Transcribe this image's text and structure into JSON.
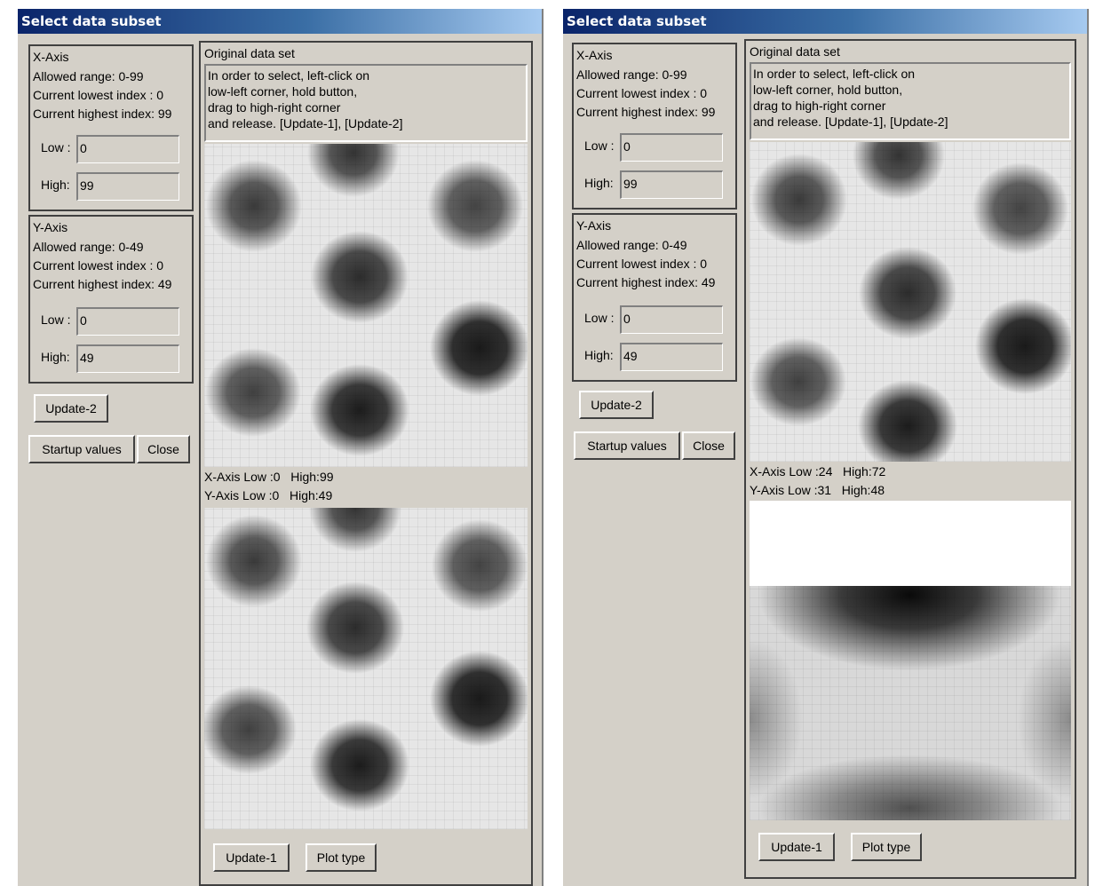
{
  "left": {
    "title": "Select data subset",
    "x_axis": {
      "title": "X-Axis",
      "allowed_range": "Allowed range: 0-99",
      "current_lowest": "Current lowest index : 0",
      "current_highest": "Current highest index: 99",
      "low_label": "Low :",
      "low_value": "0",
      "high_label": "High:",
      "high_value": "99"
    },
    "y_axis": {
      "title": "Y-Axis",
      "allowed_range": "Allowed range: 0-49",
      "current_lowest": "Current lowest index : 0",
      "current_highest": "Current highest index: 49",
      "low_label": "Low :",
      "low_value": "0",
      "high_label": "High:",
      "high_value": "49"
    },
    "update2_label": "Update-2",
    "startup_label": "Startup values",
    "close_label": "Close",
    "original_title": "Original data set",
    "instructions": [
      "In order to select, left-click on",
      "low-left corner, hold button,",
      "drag to high-right corner",
      "and release. [Update-1], [Update-2]"
    ],
    "selection": {
      "x_label": "X-Axis Low :0",
      "x_high": "High:99",
      "y_label": "Y-Axis Low :0",
      "y_high": "High:49"
    },
    "update1_label": "Update-1",
    "plot_type_label": "Plot type"
  },
  "right": {
    "title": "Select data subset",
    "x_axis": {
      "title": "X-Axis",
      "allowed_range": "Allowed range: 0-99",
      "current_lowest": "Current lowest index : 0",
      "current_highest": "Current highest index: 99",
      "low_label": "Low :",
      "low_value": "0",
      "high_label": "High:",
      "high_value": "99"
    },
    "y_axis": {
      "title": "Y-Axis",
      "allowed_range": "Allowed range: 0-49",
      "current_lowest": "Current lowest index : 0",
      "current_highest": "Current highest index: 49",
      "low_label": "Low :",
      "low_value": "0",
      "high_label": "High:",
      "high_value": "49"
    },
    "update2_label": "Update-2",
    "startup_label": "Startup values",
    "close_label": "Close",
    "original_title": "Original data set",
    "instructions": [
      "In order to select, left-click on",
      "low-left corner, hold button,",
      "drag to high-right corner",
      "and release. [Update-1], [Update-2]"
    ],
    "selection": {
      "x_label": "X-Axis   Low :24",
      "x_high": "High:72",
      "y_label": "Y-Axis   Low :31",
      "y_high": "High:48"
    },
    "update1_label": "Update-1",
    "plot_type_label": "Plot type"
  }
}
